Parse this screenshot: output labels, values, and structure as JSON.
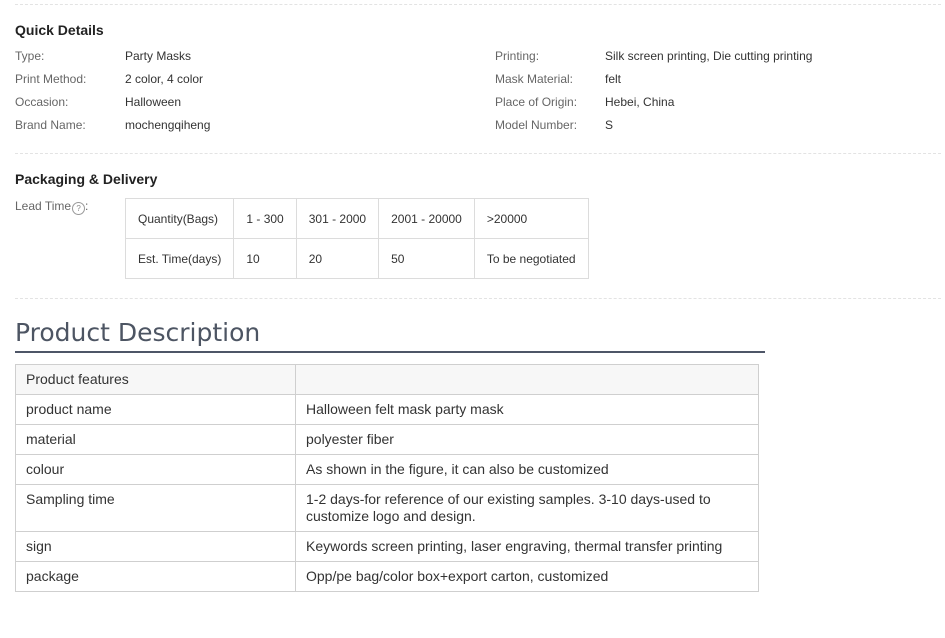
{
  "quick_details": {
    "title": "Quick Details",
    "left": [
      {
        "label": "Type:",
        "value": "Party Masks"
      },
      {
        "label": "Print Method:",
        "value": "2 color, 4 color"
      },
      {
        "label": "Occasion:",
        "value": "Halloween"
      },
      {
        "label": "Brand Name:",
        "value": "mochengqiheng"
      }
    ],
    "right": [
      {
        "label": "Printing:",
        "value": "Silk screen printing, Die cutting printing"
      },
      {
        "label": "Mask Material:",
        "value": "felt"
      },
      {
        "label": "Place of Origin:",
        "value": "Hebei, China"
      },
      {
        "label": "Model Number:",
        "value": "S"
      }
    ]
  },
  "packaging": {
    "title": "Packaging & Delivery",
    "lead_time_label": "Lead Time",
    "help_icon": "?",
    "table": [
      [
        "Quantity(Bags)",
        "1 - 300",
        "301 - 2000",
        "2001 - 20000",
        ">20000"
      ],
      [
        "Est. Time(days)",
        "10",
        "20",
        "50",
        "To be negotiated"
      ]
    ]
  },
  "product_description": {
    "title": "Product Description",
    "rows": [
      [
        "Product features",
        ""
      ],
      [
        "product name",
        "Halloween felt mask party mask"
      ],
      [
        "material",
        "polyester fiber"
      ],
      [
        "colour",
        "As shown in the figure, it can also be customized"
      ],
      [
        "Sampling time",
        "1-2 days-for reference of our existing samples. 3-10 days-used to customize logo and design."
      ],
      [
        "sign",
        "Keywords screen printing, laser engraving, thermal transfer printing"
      ],
      [
        "package",
        "Opp/pe bag/color box+export carton, customized"
      ]
    ]
  }
}
